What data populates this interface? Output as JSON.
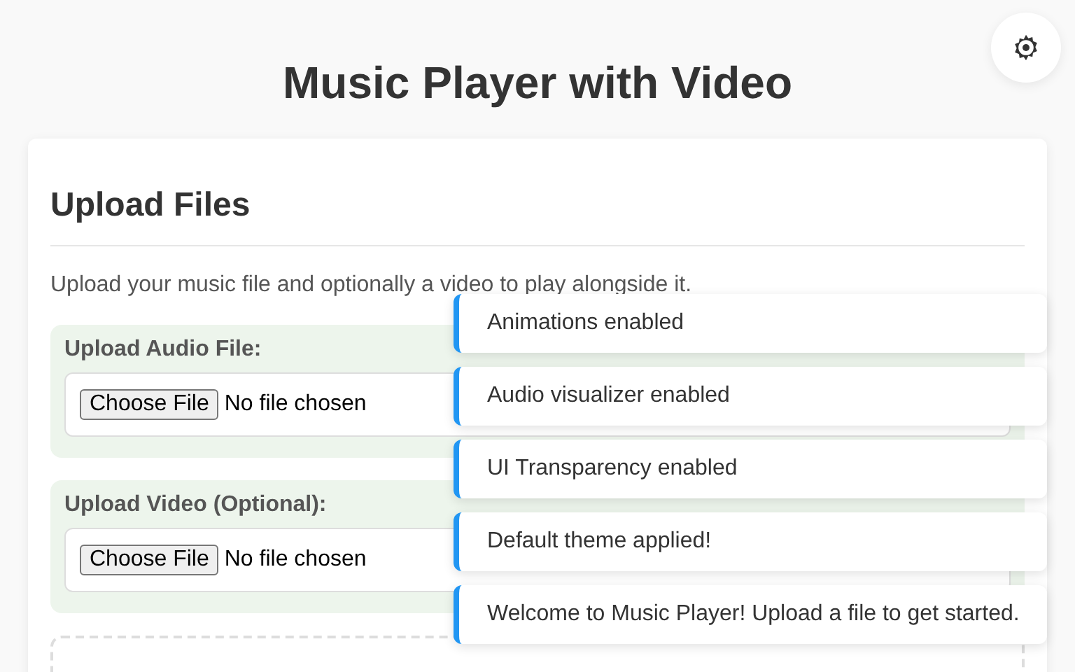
{
  "title": "Music Player with Video",
  "upload_section": {
    "heading": "Upload Files",
    "description": "Upload your music file and optionally a video to play alongside it.",
    "fields": [
      {
        "label": "Upload Audio File:",
        "button": "Choose File",
        "status": "No file chosen"
      },
      {
        "label": "Upload Video (Optional):",
        "button": "Choose File",
        "status": "No file chosen"
      }
    ]
  },
  "notifications": [
    {
      "message": "Animations enabled"
    },
    {
      "message": "Audio visualizer enabled"
    },
    {
      "message": "UI Transparency enabled"
    },
    {
      "message": "Default theme applied!"
    },
    {
      "message": "Welcome to Music Player! Upload a file to get started."
    }
  ]
}
